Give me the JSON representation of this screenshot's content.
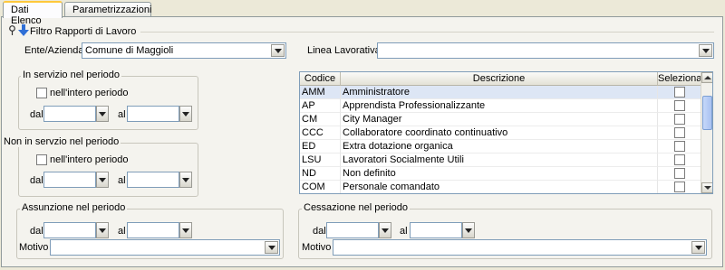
{
  "tabs": [
    {
      "label": "Dati Elenco",
      "active": true
    },
    {
      "label": "Parametrizzazioni",
      "active": false
    }
  ],
  "filter": {
    "title": "Filtro Rapporti di Lavoro",
    "ente_label": "Ente/Azienda",
    "ente_value": "Comune di Maggioli",
    "linea_label": "Linea Lavorativa",
    "linea_value": ""
  },
  "in_servizio": {
    "title": "In servizio nel periodo",
    "intero_label": "nell'intero periodo",
    "dal_label": "dal",
    "al_label": "al"
  },
  "non_in_servizio": {
    "title": "Non in servzio nel periodo",
    "intero_label": "nell'intero periodo",
    "dal_label": "dal",
    "al_label": "al"
  },
  "assunzione": {
    "title": "Assunzione nel periodo",
    "dal_label": "dal",
    "al_label": "al",
    "motivo_label": "Motivo"
  },
  "cessazione": {
    "title": "Cessazione nel periodo",
    "dal_label": "dal",
    "al_label": "al",
    "motivo_label": "Motivo"
  },
  "table": {
    "headers": [
      "Codice",
      "Descrizione",
      "Seleziona"
    ],
    "rows": [
      {
        "codice": "AMM",
        "descrizione": "Amministratore",
        "selected": false
      },
      {
        "codice": "AP",
        "descrizione": "Apprendista Professionalizzante",
        "selected": false
      },
      {
        "codice": "CM",
        "descrizione": "City Manager",
        "selected": false
      },
      {
        "codice": "CCC",
        "descrizione": "Collaboratore coordinato continuativo",
        "selected": false
      },
      {
        "codice": "ED",
        "descrizione": "Extra dotazione organica",
        "selected": false
      },
      {
        "codice": "LSU",
        "descrizione": "Lavoratori Socialmente Utili",
        "selected": false
      },
      {
        "codice": "ND",
        "descrizione": "Non definito",
        "selected": false
      },
      {
        "codice": "COM",
        "descrizione": "Personale comandato",
        "selected": false
      }
    ]
  },
  "colors": {
    "accent_tab": "#ffc83c",
    "selection": "#dde6f5",
    "field_border": "#7f9db9"
  }
}
